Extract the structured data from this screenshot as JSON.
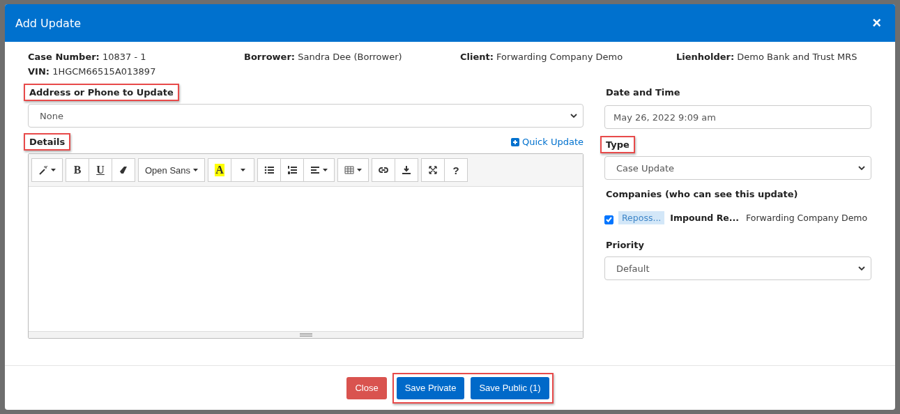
{
  "dialog": {
    "title": "Add Update",
    "close": "×"
  },
  "info": [
    {
      "label": "Case Number:",
      "value": "10837 - 1"
    },
    {
      "label": "Borrower:",
      "value": "Sandra Dee (Borrower)"
    },
    {
      "label": "Client:",
      "value": "Forwarding Company Demo"
    },
    {
      "label": "Lienholder:",
      "value": "Demo Bank and Trust MRS"
    },
    {
      "label": "VIN:",
      "value": "1HGCM66515A013897"
    }
  ],
  "address": {
    "label": "Address or Phone to Update",
    "highlighted": true,
    "value": "None"
  },
  "details": {
    "label": "Details",
    "highlighted": true,
    "quick_update": "Quick Update"
  },
  "toolbar": [
    [
      {
        "kind": "wand"
      }
    ],
    [
      {
        "kind": "bold",
        "label": "B"
      },
      {
        "kind": "underline",
        "label": "U"
      },
      {
        "kind": "eraser"
      }
    ],
    [
      {
        "kind": "font",
        "label": "Open Sans"
      }
    ],
    [
      {
        "kind": "highlight",
        "label": "A"
      },
      {
        "kind": "caret"
      }
    ],
    [
      {
        "kind": "ul"
      },
      {
        "kind": "ol"
      },
      {
        "kind": "align"
      }
    ],
    [
      {
        "kind": "table"
      }
    ],
    [
      {
        "kind": "link"
      },
      {
        "kind": "download"
      }
    ],
    [
      {
        "kind": "fullscreen"
      },
      {
        "kind": "help",
        "label": "?"
      }
    ]
  ],
  "date": {
    "label": "Date and Time",
    "value": "May 26, 2022 9:09 am"
  },
  "type": {
    "label": "Type",
    "highlighted": true,
    "value": "Case Update"
  },
  "companies": {
    "label": "Companies (who can see this update)",
    "items": [
      {
        "checked": true,
        "tag": "Reposs...",
        "name": "Impound Re...",
        "company": "Forwarding Company Demo"
      }
    ]
  },
  "priority": {
    "label": "Priority",
    "value": "Default"
  },
  "footer": {
    "highlighted": true,
    "buttons": [
      {
        "kind": "danger",
        "label": "Close"
      },
      {
        "kind": "primary",
        "label": "Save Private"
      },
      {
        "kind": "primary",
        "label": "Save Public (1)"
      }
    ]
  }
}
